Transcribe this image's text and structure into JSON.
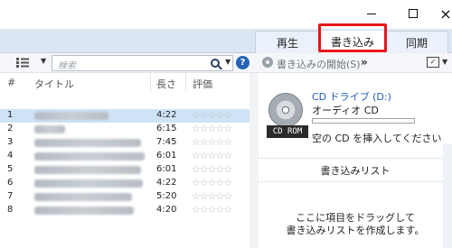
{
  "window": {
    "minimize_icon": "minimize-icon",
    "maximize_icon": "maximize-icon",
    "close_label": "×"
  },
  "tabs": [
    {
      "label": "再生",
      "active": false
    },
    {
      "label": "書き込み",
      "active": true,
      "highlighted": true
    },
    {
      "label": "同期",
      "active": false
    }
  ],
  "highlight_color": "#e8151a",
  "toolbar": {
    "search_placeholder": "検索",
    "help_label": "?",
    "burn_start": "書き込みの開始(S)",
    "more_label": "»"
  },
  "list": {
    "columns": [
      "#",
      "タイトル",
      "長さ",
      "評価"
    ],
    "rows": [
      {
        "num": "1",
        "length": "4:22",
        "stars": "☆☆☆☆☆",
        "selected": true
      },
      {
        "num": "2",
        "length": "6:15",
        "stars": "☆☆☆☆☆",
        "selected": false
      },
      {
        "num": "3",
        "length": "7:45",
        "stars": "☆☆☆☆☆",
        "selected": false
      },
      {
        "num": "4",
        "length": "6:01",
        "stars": "☆☆☆☆☆",
        "selected": false
      },
      {
        "num": "5",
        "length": "6:01",
        "stars": "☆☆☆☆☆",
        "selected": false
      },
      {
        "num": "6",
        "length": "4:22",
        "stars": "☆☆☆☆☆",
        "selected": false
      },
      {
        "num": "7",
        "length": "5:20",
        "stars": "☆☆☆☆☆",
        "selected": false
      },
      {
        "num": "8",
        "length": "4:20",
        "stars": "☆☆☆☆☆",
        "selected": false
      }
    ],
    "selected_color": "#cfe3f7"
  },
  "burn_pane": {
    "disc_label": "CD ROM",
    "drive": "CD ドライブ (D:)",
    "disc_type": "オーディオ CD",
    "capacity_fill": 0,
    "insert_prompt": "空の CD を挿入してください",
    "burn_list_title": "書き込みリスト",
    "drag_hint_line1": "ここに項目をドラッグして",
    "drag_hint_line2": "書き込みリストを作成します。"
  }
}
